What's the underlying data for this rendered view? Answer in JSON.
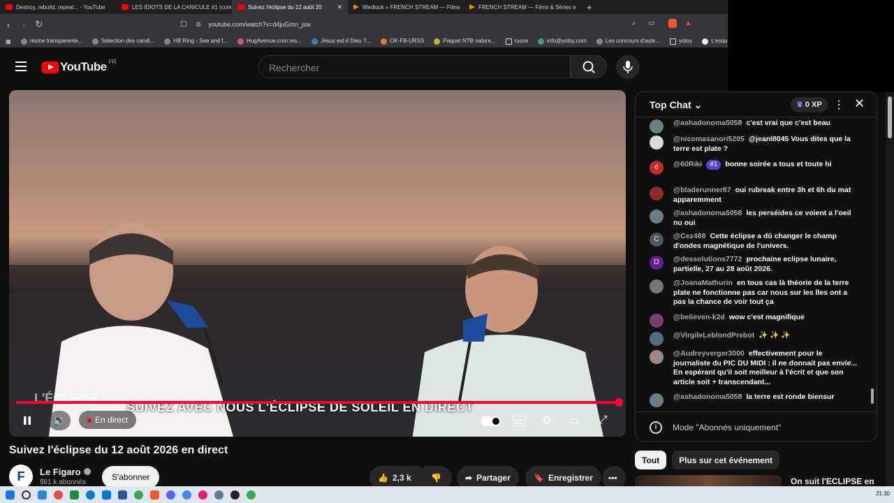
{
  "browser": {
    "tabs": [
      {
        "title": "Destroy, rebuild, repeat... - YouTube",
        "color": "#ff0000"
      },
      {
        "title": "LES IDIOTS DE LA CANICULE #1 (com",
        "color": "#ff0000"
      },
      {
        "title": "Suivez l'éclipse du 12 août 20",
        "color": "#ff0000"
      },
      {
        "title": "Wedlock » FRENCH STREAM — Films",
        "color": "#f08c00"
      },
      {
        "title": "FRENCH STREAM — Films & Séries e",
        "color": "#f08c00"
      }
    ],
    "url": "youtube.com/watch?v=d4juGmn_jsw",
    "bookmarks": [
      "résine transparente...",
      "Sélection des candi...",
      "HB Ring - See and f...",
      "HugAvenue.com res...",
      "Jésus est-il Dieu ?...",
      "OK-FB-URSS",
      "Paquet NTB nature...",
      "russe",
      "info@yotoy.com",
      "Les concours d'aute...",
      "yotoy",
      "L'esqu"
    ]
  },
  "header": {
    "logo_text": "YouTube",
    "region": "FR",
    "search_placeholder": "Rechercher"
  },
  "player": {
    "overlay_caption": "SUIVEZ AVEC NOUS L'ÉCLIPSE DE SOLEIL EN DIRECT",
    "watermark": "L'ÉCLIPSE",
    "live_label": "En direct",
    "progress_fraction": 1.0
  },
  "video": {
    "title": "Suivez l'éclipse du 12 août 2026 en direct",
    "channel_name": "Le Figaro",
    "channel_avatar": "F",
    "subscribers": "981 k abonnés",
    "subscribe_label": "S'abonner",
    "likes": "2,3 k",
    "share_label": "Partager",
    "save_label": "Enregistrer"
  },
  "chat": {
    "title": "Top Chat",
    "xp": "0 XP",
    "messages": [
      {
        "author": "@ashadonoma5058",
        "text": "c'est vrai que c'est beau",
        "avatar": "",
        "avatar_color": "#6b7d86"
      },
      {
        "author": "@nicomasanori5205",
        "text": "@jeanl8045 Vous dites que la terre est plate ?",
        "avatar": "",
        "avatar_color": "#d9d9d9"
      },
      {
        "author": "@60Riki",
        "rank": "#1",
        "text": "bonne soirée a tous et toute hi",
        "avatar": "é",
        "avatar_color": "#c62828"
      },
      {
        "author": "@bladerunner87",
        "text": "oui rubreak entre 3h et 6h du mat apparemment",
        "avatar": "",
        "avatar_color": "#8a2b2b"
      },
      {
        "author": "@ashadonoma5058",
        "text": "les perséides ce voient a l'oeil nu oui",
        "avatar": "",
        "avatar_color": "#6b7d86"
      },
      {
        "author": "@Cez488",
        "text": "Cette éclipse a dû changer le champ d'ondes magnétique de l'univers.",
        "avatar": "C",
        "avatar_color": "#455a64"
      },
      {
        "author": "@dessolutions7772",
        "text": "prochaine eclipse lunaire, partielle, 27 au 28 août 2026.",
        "avatar": "D",
        "avatar_color": "#6a1b9a"
      },
      {
        "author": "@JoanaMathurin",
        "text": "en tous cas là théorie de la terre plate ne fonctionne pas car nous sur les îles ont a pas la chance de voir tout ça",
        "avatar": "",
        "avatar_color": "#777777"
      },
      {
        "author": "@believen-k2d",
        "text": "wow c'est magnifique",
        "avatar": "",
        "avatar_color": "#7b3f6e"
      },
      {
        "author": "@VirgileLeblondPrebot",
        "text": "✨ ✨ ✨",
        "avatar": "",
        "avatar_color": "#4f6f7f"
      },
      {
        "author": "@Audreyverger3000",
        "text": "effectivement pour le journaliste du PIC DU MIDI : il ne donnait pas envie... En espérant qu'il soit meilleur à l'écrit et que son article soit + transcendant...",
        "avatar": "",
        "avatar_color": "#a1887f"
      },
      {
        "author": "@ashadonoma5058",
        "text": "la terre est ronde biensur",
        "avatar": "",
        "avatar_color": "#6b7d86"
      }
    ],
    "mode_notice": "Mode \"Abonnés uniquement\""
  },
  "chips": [
    "Tout",
    "Plus sur cet événement"
  ],
  "recommendation": {
    "title": "On suit l'ECLIPSE en"
  }
}
